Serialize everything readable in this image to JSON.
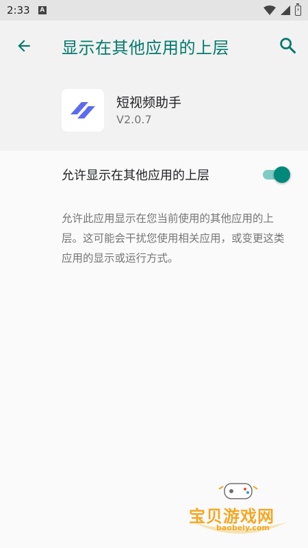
{
  "status_bar": {
    "time": "2:33",
    "notification_icon": "a-icon",
    "battery_icon": "battery-icon"
  },
  "app_bar": {
    "title": "显示在其他应用的上层",
    "back_icon": "back-arrow-icon",
    "search_icon": "search-icon"
  },
  "app": {
    "name": "短视频助手",
    "version": "V2.0.7"
  },
  "permission": {
    "label": "允许显示在其他应用的上层",
    "enabled": true,
    "description": "允许此应用显示在您当前使用的其他应用的上层。这可能会干扰您使用相关应用，或变更这类应用的显示或运行方式。"
  },
  "watermark": {
    "text": "宝贝游戏网",
    "url": "baobeiy.com"
  },
  "colors": {
    "accent": "#00796b",
    "switch_thumb": "#00897b",
    "switch_track": "#80cbc4",
    "app_icon": "#5b6cf0"
  }
}
